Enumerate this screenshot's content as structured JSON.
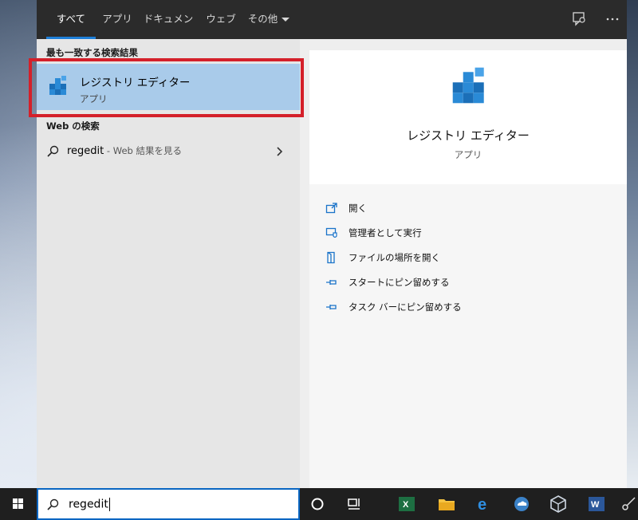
{
  "tabs": [
    {
      "label": "すべて"
    },
    {
      "label": "アプリ"
    },
    {
      "label": "ドキュメント"
    },
    {
      "label": "ウェブ"
    },
    {
      "label": "その他"
    }
  ],
  "results": {
    "best_match_heading": "最も一致する検索結果",
    "best_match": {
      "title": "レジストリ エディター",
      "subtitle": "アプリ"
    },
    "web_heading": "Web の検索",
    "web_query": "regedit",
    "web_hint": " - Web 結果を見る"
  },
  "detail": {
    "title": "レジストリ エディター",
    "subtitle": "アプリ",
    "actions": [
      {
        "label": "開く",
        "icon": "open-icon"
      },
      {
        "label": "管理者として実行",
        "icon": "run-as-admin-icon"
      },
      {
        "label": "ファイルの場所を開く",
        "icon": "file-location-icon"
      },
      {
        "label": "スタートにピン留めする",
        "icon": "pin-icon"
      },
      {
        "label": "タスク バーにピン留めする",
        "icon": "pin-icon"
      }
    ]
  },
  "search": {
    "value": "regedit"
  },
  "colors": {
    "accent": "#1e7fd8",
    "selection": "#a9cbea",
    "highlight_border": "#d4202a"
  }
}
